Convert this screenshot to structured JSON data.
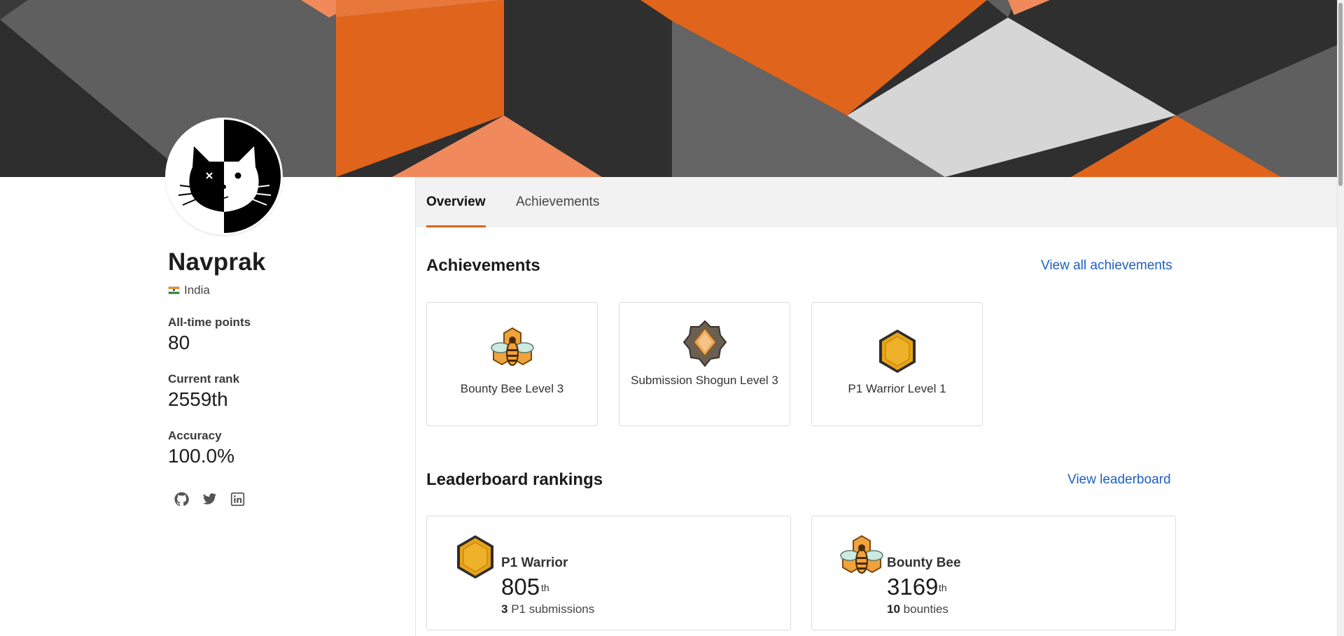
{
  "profile": {
    "username": "Navprak",
    "country": "India",
    "avatar_icon": "cat-avatar-icon"
  },
  "stats": [
    {
      "label": "All-time points",
      "value": "80"
    },
    {
      "label": "Current rank",
      "value": "2559th"
    },
    {
      "label": "Accuracy",
      "value": "100.0%"
    }
  ],
  "socials": [
    "github-icon",
    "twitter-icon",
    "linkedin-icon"
  ],
  "tabs": [
    {
      "label": "Overview",
      "active": true
    },
    {
      "label": "Achievements",
      "active": false
    }
  ],
  "achievements_section": {
    "title": "Achievements",
    "link": "View all achievements",
    "items": [
      {
        "label": "Bounty Bee Level 3",
        "icon": "bounty-bee-badge-icon"
      },
      {
        "label": "Submission Shogun Level 3",
        "icon": "submission-shogun-badge-icon"
      },
      {
        "label": "P1 Warrior Level 1",
        "icon": "p1-warrior-badge-icon"
      }
    ]
  },
  "leaderboard_section": {
    "title": "Leaderboard rankings",
    "link": "View leaderboard",
    "items": [
      {
        "title": "P1 Warrior",
        "rank": "805",
        "suffix": "th",
        "count": "3",
        "count_label": "P1 submissions",
        "icon": "p1-warrior-badge-icon"
      },
      {
        "title": "Bounty Bee",
        "rank": "3169",
        "suffix": "th",
        "count": "10",
        "count_label": "bounties",
        "icon": "bounty-bee-badge-icon"
      }
    ]
  },
  "colors": {
    "accent": "#e0641b",
    "link": "#1f5fbf",
    "banner_dark": "#2f2f2f",
    "banner_grey": "#666666",
    "banner_orange": "#e0641b",
    "banner_light": "#d9d9d9"
  }
}
